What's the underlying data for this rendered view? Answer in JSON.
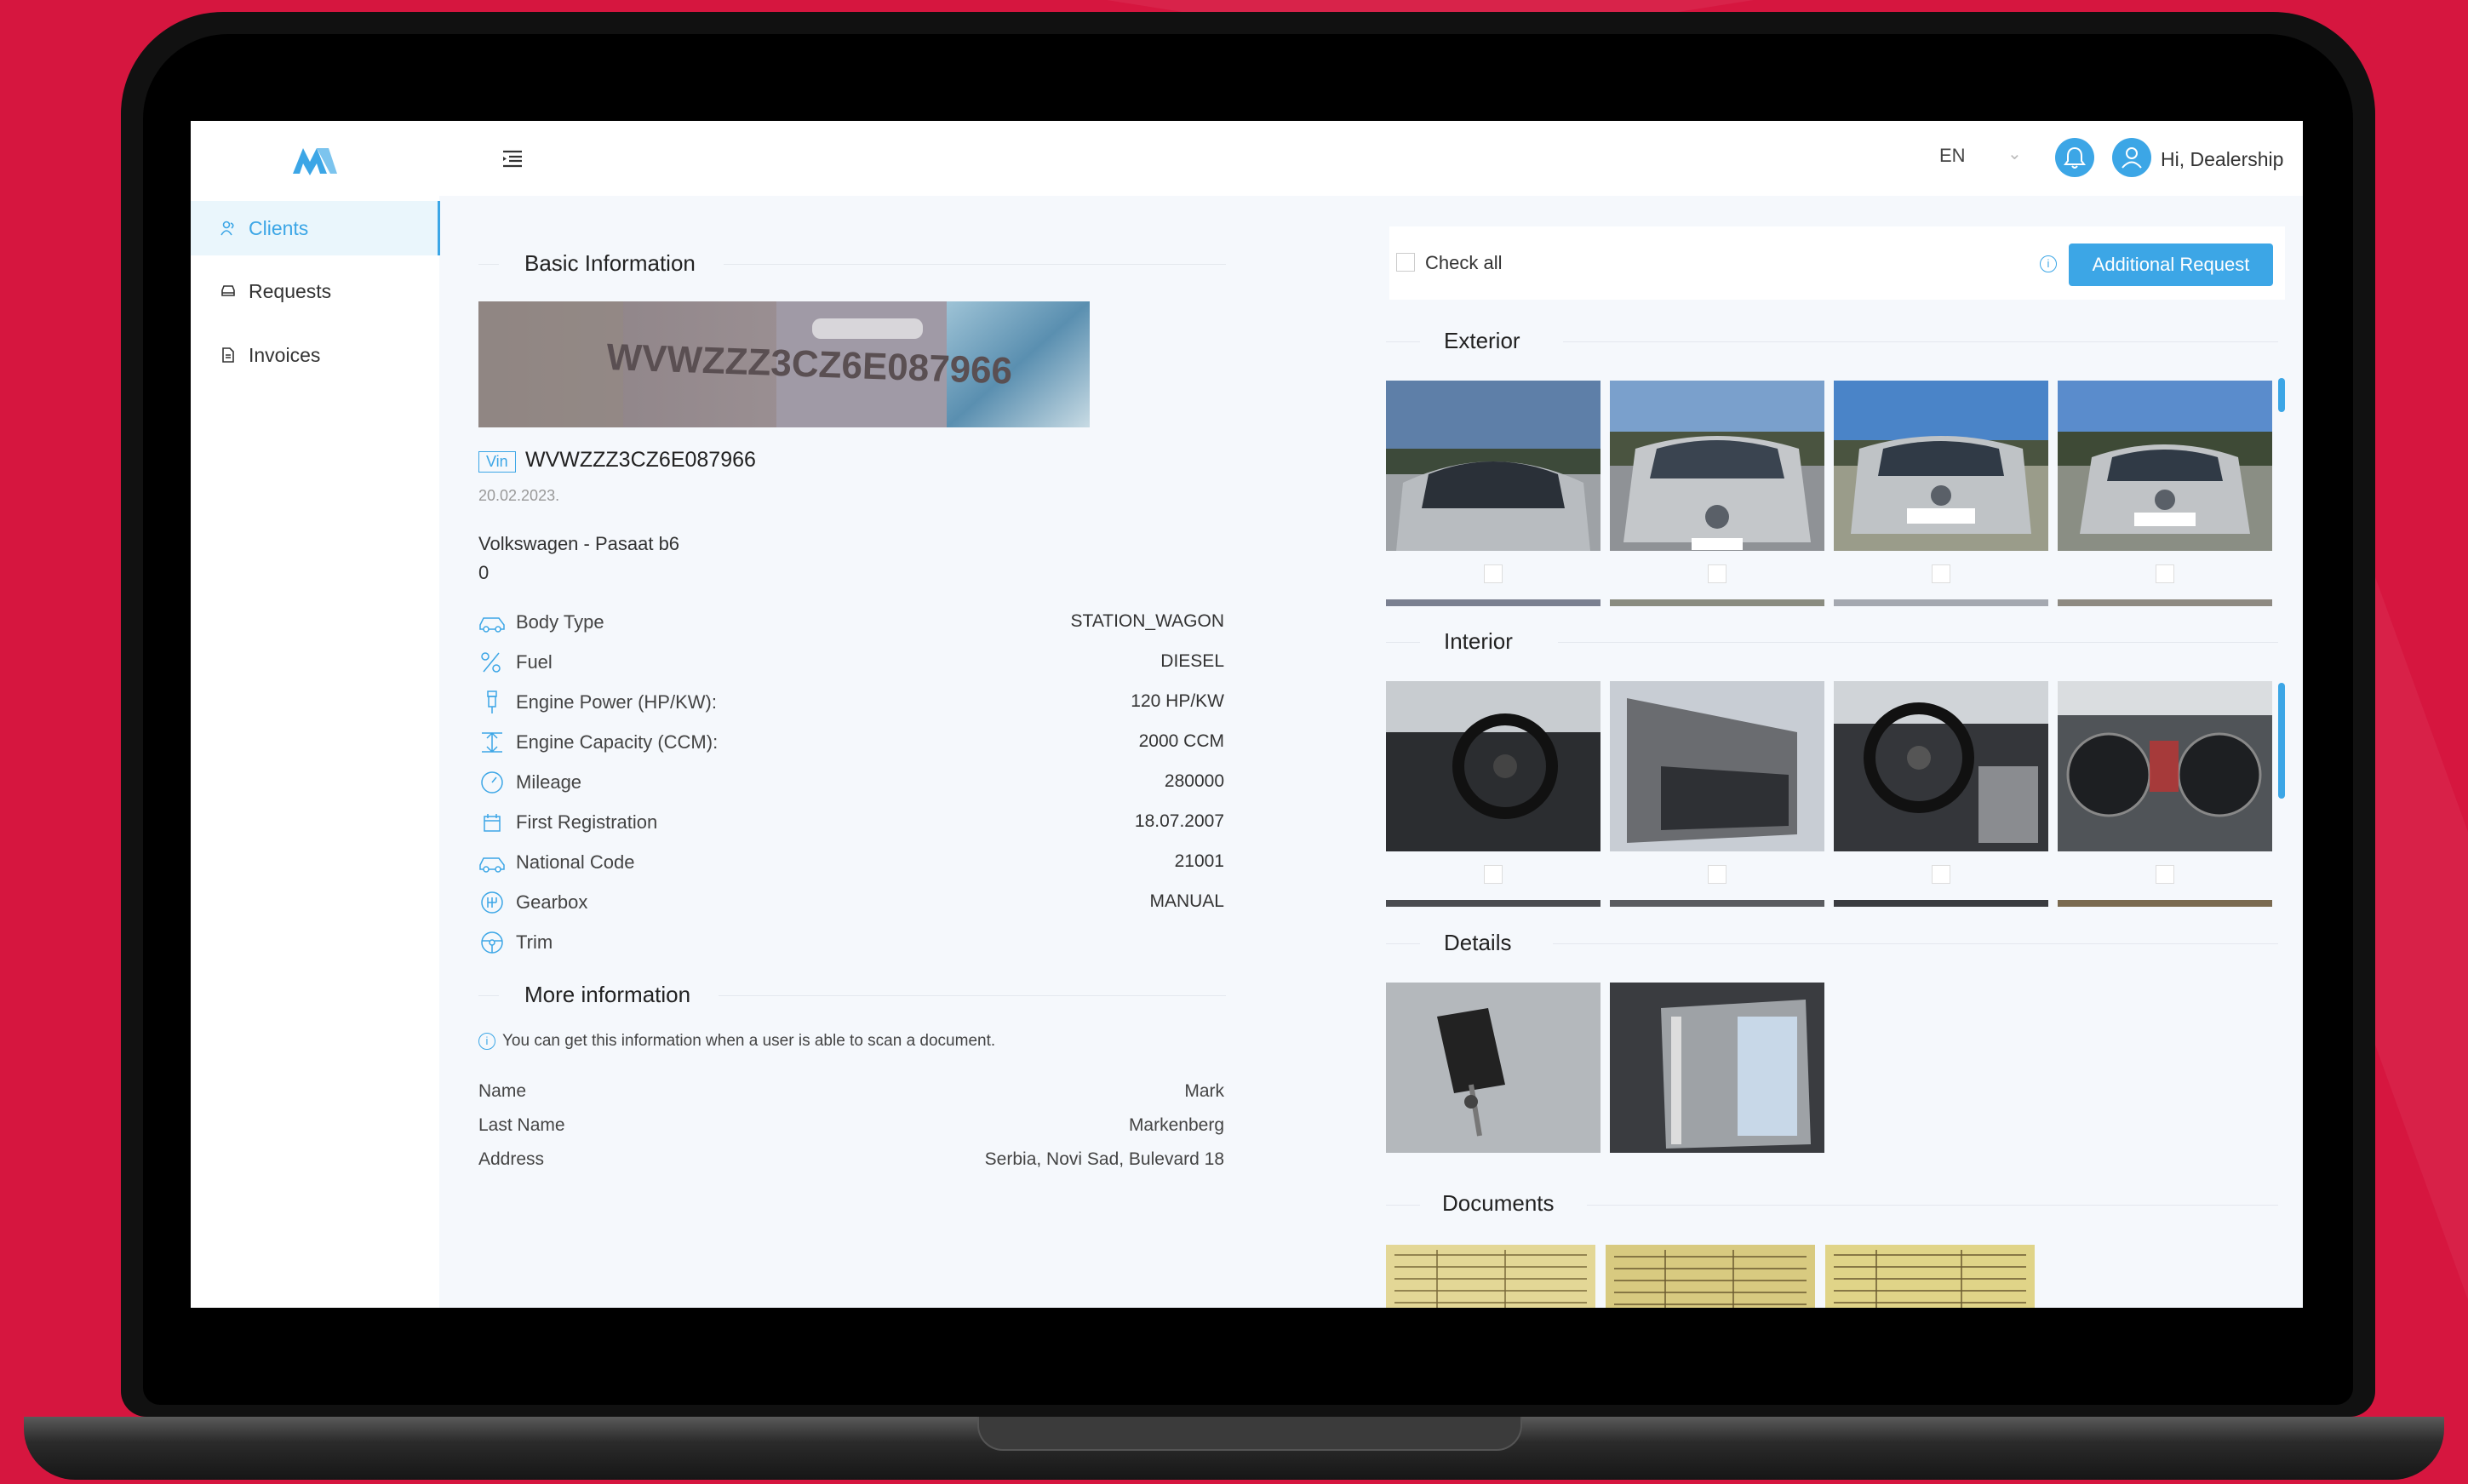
{
  "topbar": {
    "language": "EN",
    "greeting": "Hi, Dealership"
  },
  "sidebar": {
    "items": [
      {
        "label": "Clients",
        "icon": "clients-icon",
        "active": true
      },
      {
        "label": "Requests",
        "icon": "car-icon",
        "active": false
      },
      {
        "label": "Invoices",
        "icon": "invoice-icon",
        "active": false
      }
    ]
  },
  "basic_info": {
    "title": "Basic Information",
    "vin_badge": "Vin",
    "vin": "WVWZZZ3CZ6E087966",
    "date": "20.02.2023.",
    "model": "Volkswagen - Pasaat b6",
    "model_sub": "0",
    "specs": [
      {
        "label": "Body Type",
        "value": "STATION_WAGON",
        "icon": "car-body-icon"
      },
      {
        "label": "Fuel",
        "value": "DIESEL",
        "icon": "fuel-icon"
      },
      {
        "label": "Engine Power (HP/KW):",
        "value": "120 HP/KW",
        "icon": "engine-power-icon"
      },
      {
        "label": "Engine Capacity (CCM):",
        "value": "2000 CCM",
        "icon": "engine-capacity-icon"
      },
      {
        "label": "Mileage",
        "value": "280000",
        "icon": "mileage-icon"
      },
      {
        "label": "First Registration",
        "value": "18.07.2007",
        "icon": "calendar-icon"
      },
      {
        "label": "National Code",
        "value": "21001",
        "icon": "car-code-icon"
      },
      {
        "label": "Gearbox",
        "value": "MANUAL",
        "icon": "gearbox-icon"
      },
      {
        "label": "Trim",
        "value": "",
        "icon": "steering-wheel-icon"
      }
    ]
  },
  "more_info": {
    "title": "More information",
    "notice": "You can get this information when a user is able to scan a document.",
    "rows": [
      {
        "label": "Name",
        "value": "Mark"
      },
      {
        "label": "Last Name",
        "value": "Markenberg"
      },
      {
        "label": "Address",
        "value": "Serbia, Novi Sad, Bulevard 18"
      }
    ]
  },
  "gallery": {
    "check_all": "Check all",
    "additional_request": "Additional Request",
    "categories": [
      {
        "title": "Exterior"
      },
      {
        "title": "Interior"
      },
      {
        "title": "Details"
      },
      {
        "title": "Documents"
      }
    ]
  },
  "colors": {
    "accent": "#3ca6e6",
    "background": "#d6163f",
    "screen_bg": "#f5f8fc"
  }
}
